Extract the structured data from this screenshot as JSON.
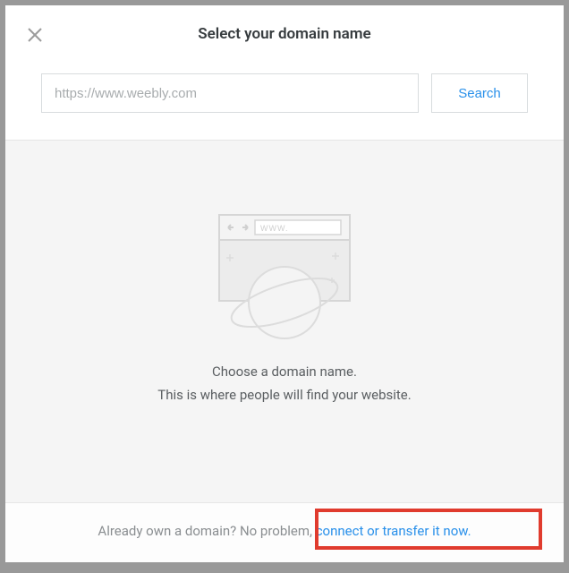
{
  "header": {
    "title": "Select your domain name"
  },
  "search": {
    "placeholder": "https://www.weebly.com",
    "button_label": "Search"
  },
  "empty_state": {
    "heading": "Choose a domain name.",
    "subheading": "This is where people will find your website."
  },
  "footer": {
    "prefix": "Already own a domain? No problem, ",
    "link_text": "connect or transfer it now."
  }
}
